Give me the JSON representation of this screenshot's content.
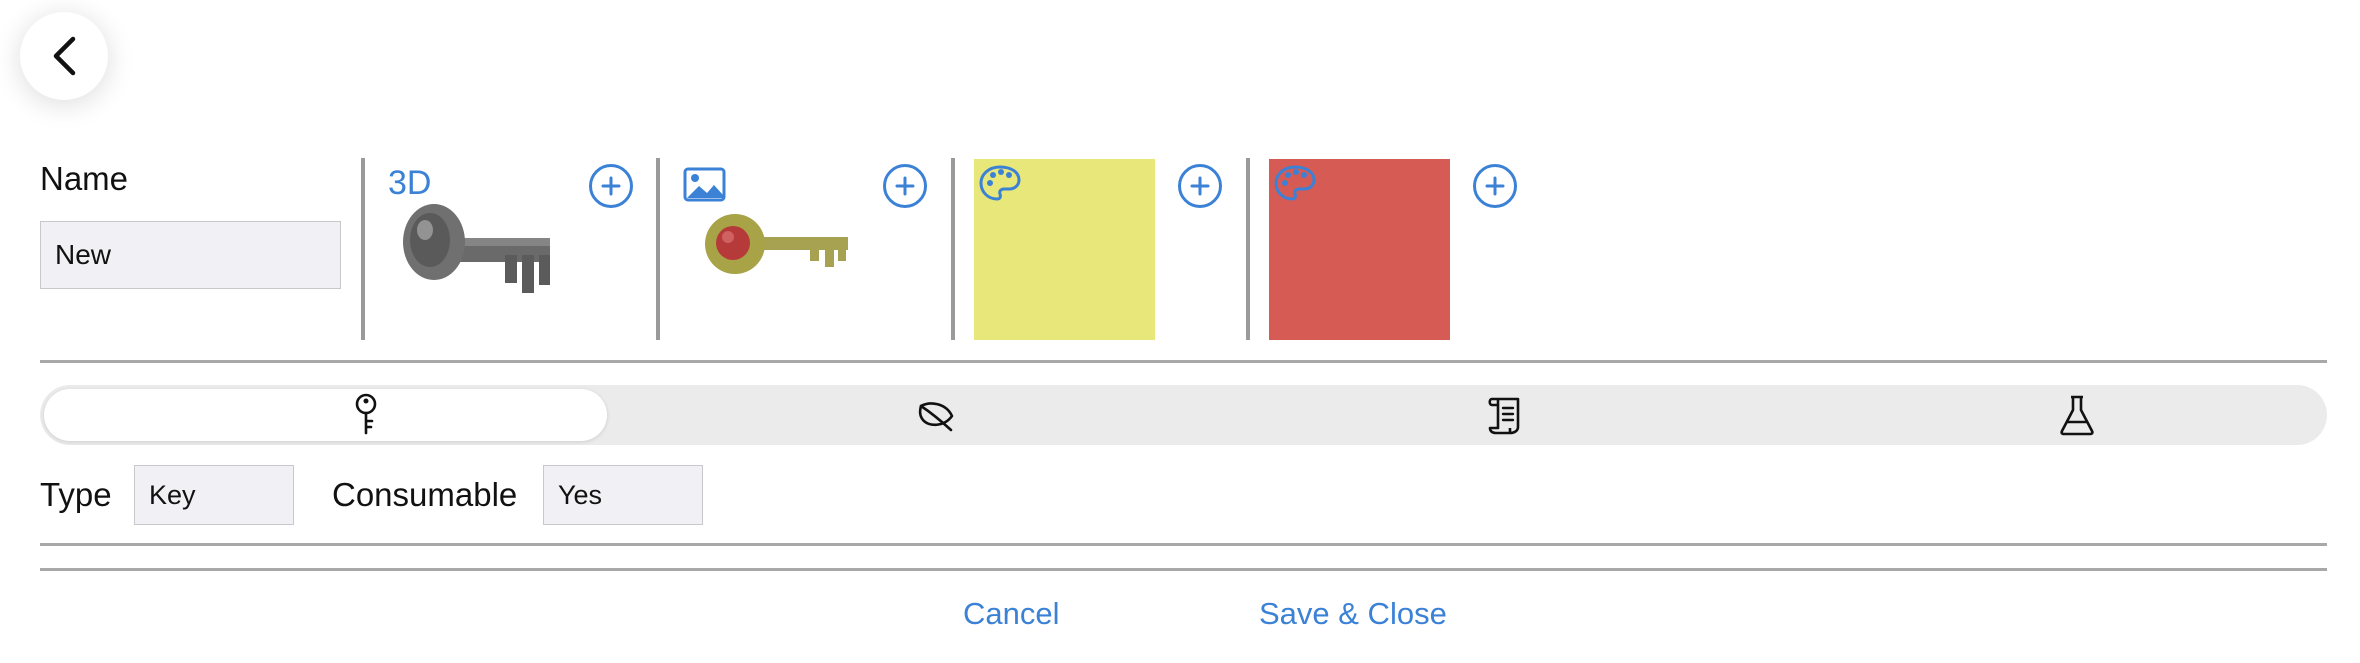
{
  "back_button": {
    "icon": "chevron-left-icon"
  },
  "name": {
    "label": "Name",
    "value": "New"
  },
  "assets": {
    "model_3d": {
      "label": "3D",
      "icon": "key-3d-model"
    },
    "image": {
      "icon": "image-icon"
    },
    "color_1": {
      "icon": "palette-icon",
      "color": "#E8E77A"
    },
    "color_2": {
      "icon": "palette-icon",
      "color": "#D65B55"
    },
    "add_icon": "plus-circle-icon"
  },
  "tabs": [
    {
      "icon": "key-icon",
      "selected": true
    },
    {
      "icon": "leaf-icon",
      "selected": false
    },
    {
      "icon": "scroll-icon",
      "selected": false
    },
    {
      "icon": "flask-icon",
      "selected": false
    }
  ],
  "properties": {
    "type_label": "Type",
    "type_value": "Key",
    "consumable_label": "Consumable",
    "consumable_value": "Yes"
  },
  "footer": {
    "cancel_label": "Cancel",
    "save_label": "Save & Close"
  },
  "colors": {
    "accent": "#3B82D6"
  }
}
